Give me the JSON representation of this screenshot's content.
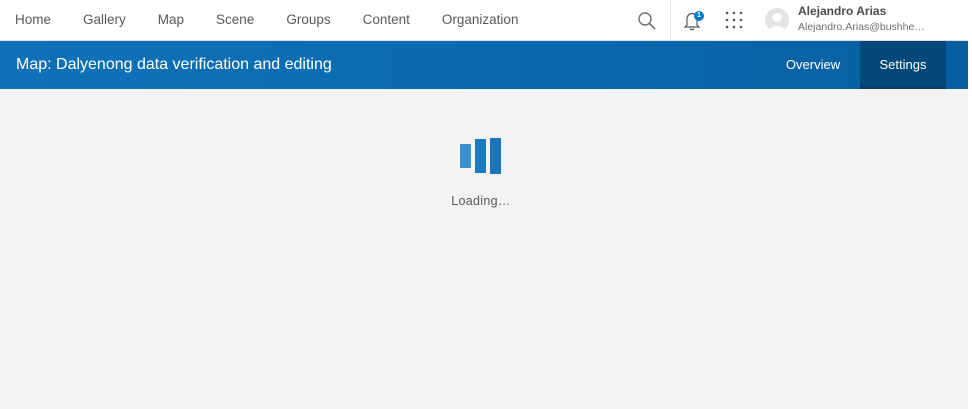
{
  "nav": {
    "links": [
      "Home",
      "Gallery",
      "Map",
      "Scene",
      "Groups",
      "Content",
      "Organization"
    ],
    "notifications_count": "1"
  },
  "user": {
    "name": "Alejandro Arias",
    "email": "Alejandro.Arias@bushhe…"
  },
  "titlebar": {
    "title": "Map: Dalyenong data verification and editing",
    "tabs": [
      "Overview",
      "Settings"
    ],
    "active_tab": "Settings"
  },
  "loading": {
    "text": "Loading…"
  },
  "icons": {
    "search": "search-icon",
    "notifications": "bell-icon",
    "apps": "apps-grid-icon",
    "avatar": "user-avatar-icon",
    "loader": "loading-bars-icon"
  },
  "colors": {
    "brand_blue": "#0079c1",
    "title_bar": "#0a68ad",
    "active_tab": "#05497a",
    "background": "#f3f3f3"
  }
}
